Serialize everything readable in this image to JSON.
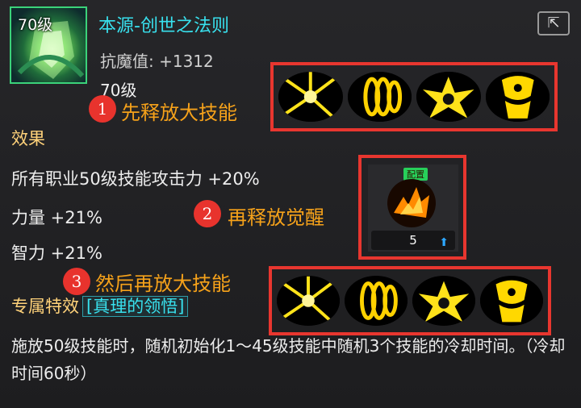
{
  "item": {
    "level_badge": "70级",
    "name": "本源-创世之法则",
    "stat_label": "抗魔值: +1312",
    "level_req": "70级",
    "share_icon": "share-icon"
  },
  "effects": {
    "title": "效果",
    "lines": [
      "所有职业50级技能攻击力 +20%",
      "力量 +21%",
      "智力 +21%"
    ]
  },
  "special": {
    "label": "专属特效",
    "tag": "[真理的领悟]"
  },
  "description": "施放50级技能时，随机初始化1～45级技能中随机3个技能的冷却时间。（冷却时间60秒）",
  "annotations": [
    {
      "num": "1",
      "text": "先释放大技能"
    },
    {
      "num": "2",
      "text": "再释放觉醒"
    },
    {
      "num": "3",
      "text": "然后再放大技能"
    }
  ],
  "awaken": {
    "config_label": "配置",
    "count": "5"
  },
  "colors": {
    "title": "#38e1ee",
    "accent": "#ffd27a",
    "annotation": "#f6a21a",
    "highlight_box": "#e8362f"
  }
}
